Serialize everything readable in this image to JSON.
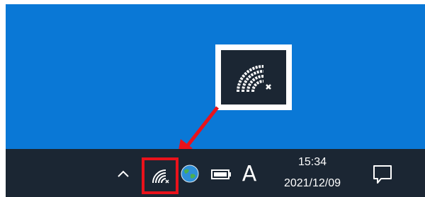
{
  "taskbar": {
    "clock": {
      "time": "15:34",
      "date": "2021/12/09"
    },
    "ime_indicator": "A",
    "tray_icons": [
      "chevron-up-icon",
      "wifi-icon",
      "globe-icon",
      "battery-icon",
      "action-center-icon"
    ]
  },
  "annotation": {
    "highlight_color": "#e9121b",
    "zoomed_icon": "wifi-icon"
  },
  "colors": {
    "desktop": "#0a78d6",
    "taskbar": "#1b2633",
    "icon": "#ffffff"
  }
}
